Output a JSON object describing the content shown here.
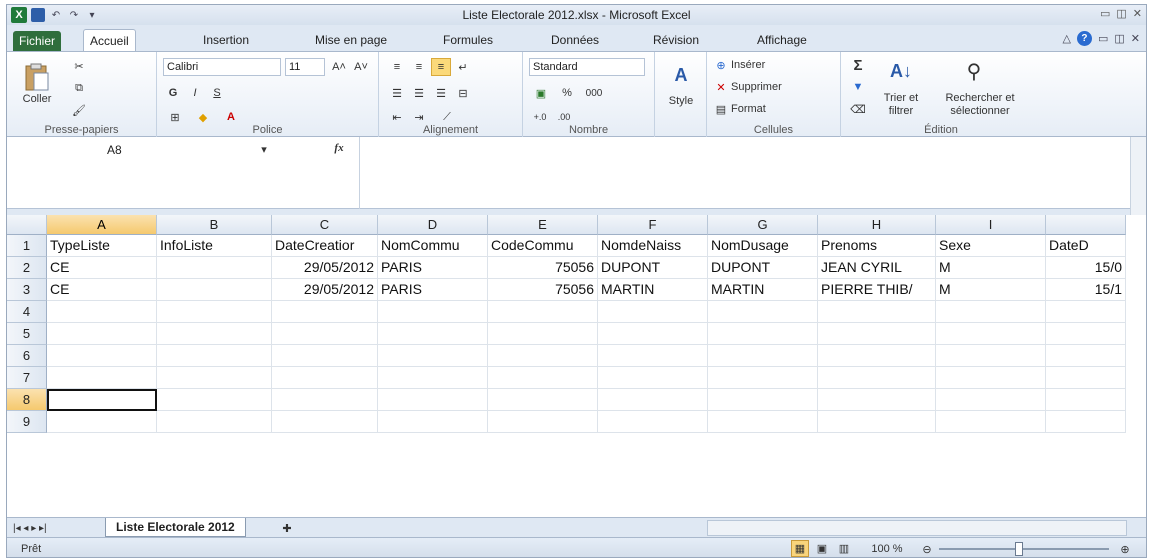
{
  "window": {
    "title": "Liste Electorale 2012.xlsx - Microsoft Excel"
  },
  "tabs": [
    "Fichier",
    "Accueil",
    "Insertion",
    "Mise en page",
    "Formules",
    "Données",
    "Révision",
    "Affichage"
  ],
  "ribbon": {
    "clipboard": {
      "paste": "Coller",
      "label": "Presse-papiers"
    },
    "font": {
      "name": "Calibri",
      "size": "11",
      "bold": "G",
      "italic": "I",
      "underline": "S",
      "label": "Police"
    },
    "alignment": {
      "label": "Alignement"
    },
    "number": {
      "format": "Standard",
      "percent": "%",
      "thousands": "000",
      "label": "Nombre"
    },
    "style": {
      "label": "Style"
    },
    "cells": {
      "insert": "Insérer",
      "delete": "Supprimer",
      "format": "Format",
      "label": "Cellules"
    },
    "editing": {
      "sigma": "Σ",
      "sort": "Trier et filtrer",
      "find": "Rechercher et sélectionner",
      "label": "Édition"
    }
  },
  "formula_bar": {
    "namebox": "A8",
    "fx": "fx",
    "value": ""
  },
  "columns": [
    "A",
    "B",
    "C",
    "D",
    "E",
    "F",
    "G",
    "H",
    "I",
    ""
  ],
  "rows": [
    [
      "TypeListe",
      "InfoListe",
      "DateCreatior",
      "NomCommu",
      "CodeCommu",
      "NomdeNaiss",
      "NomDusage",
      "Prenoms",
      "Sexe",
      "DateD"
    ],
    [
      "CE",
      "",
      "29/05/2012",
      "PARIS",
      "75056",
      "DUPONT",
      "DUPONT",
      "JEAN CYRIL",
      "M",
      "15/0"
    ],
    [
      "CE",
      "",
      "29/05/2012",
      "PARIS",
      "75056",
      "MARTIN",
      "MARTIN",
      "PIERRE THIB/",
      "M",
      "15/1"
    ],
    [
      "",
      "",
      "",
      "",
      "",
      "",
      "",
      "",
      "",
      ""
    ],
    [
      "",
      "",
      "",
      "",
      "",
      "",
      "",
      "",
      "",
      ""
    ],
    [
      "",
      "",
      "",
      "",
      "",
      "",
      "",
      "",
      "",
      ""
    ],
    [
      "",
      "",
      "",
      "",
      "",
      "",
      "",
      "",
      "",
      ""
    ],
    [
      "",
      "",
      "",
      "",
      "",
      "",
      "",
      "",
      "",
      ""
    ],
    [
      "",
      "",
      "",
      "",
      "",
      "",
      "",
      "",
      "",
      ""
    ]
  ],
  "row_numbers": [
    "1",
    "2",
    "3",
    "4",
    "5",
    "6",
    "7",
    "8",
    "9"
  ],
  "sheet_tab": "Liste Electorale 2012",
  "status": {
    "ready": "Prêt",
    "zoom": "100 %"
  }
}
